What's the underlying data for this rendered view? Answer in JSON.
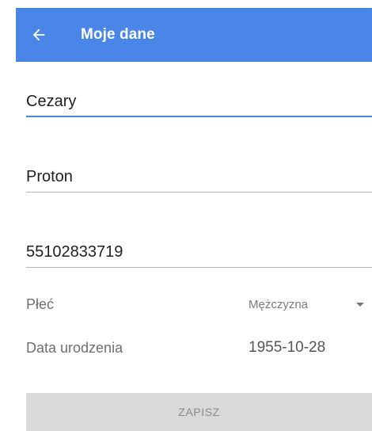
{
  "header": {
    "title": "Moje dane",
    "background_color": "#4a86e8",
    "back_icon": "arrow-left-icon"
  },
  "form": {
    "first_name": "Cezary",
    "last_name": "Proton",
    "pesel": "55102833719",
    "gender": {
      "label": "Płeć",
      "selected": "Mężczyzna",
      "dropdown_icon": "caret-down-icon"
    },
    "birth_date": {
      "label": "Data urodzenia",
      "value": "1955-10-28"
    },
    "accent_color": "#4a86e8"
  },
  "actions": {
    "save_label": "ZAPISZ",
    "save_enabled": false
  }
}
